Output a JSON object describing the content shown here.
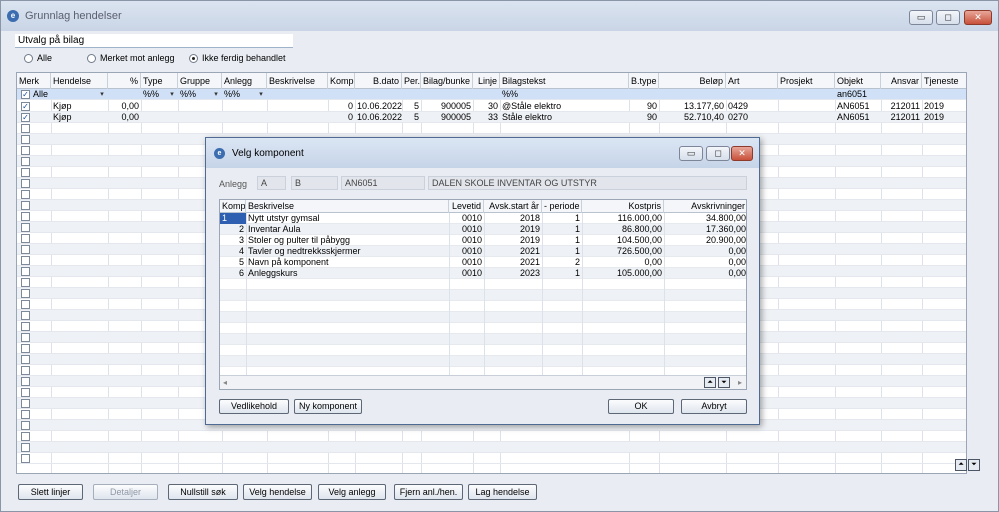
{
  "window": {
    "title": "Grunnlag hendelser",
    "icon": "app-logo-icon"
  },
  "window_buttons": {
    "minimize": "▭",
    "maximize": "◻",
    "close": "✕"
  },
  "selection": {
    "title": "Utvalg på bilag",
    "options": [
      {
        "label": "Alle",
        "selected": false
      },
      {
        "label": "Merket mot anlegg",
        "selected": false
      },
      {
        "label": "Ikke ferdig behandlet",
        "selected": true
      }
    ]
  },
  "grid": {
    "headers": [
      "Merk",
      "Hendelse",
      "%",
      "Type",
      "Gruppe",
      "Anlegg",
      "Beskrivelse",
      "Komp",
      "B.dato",
      "Per.",
      "Bilag/bunke",
      "Linje",
      "Bilagstekst",
      "B.type",
      "Beløp",
      "Art",
      "Prosjekt",
      "Objekt",
      "Ansvar",
      "Tjeneste"
    ],
    "filter_row": {
      "merk": "Alle",
      "type": "%%",
      "gruppe": "%%",
      "anlegg": "%%",
      "bilagstekst": "%%",
      "objekt": "an6051"
    },
    "rows": [
      {
        "merk": "✓",
        "hendelse": "Kjøp",
        "pct": "0,00",
        "komp": "0",
        "bdato": "10.06.2022",
        "per": "5",
        "bilag": "900005",
        "linje": "30",
        "bilagstekst": "@Ståle elektro",
        "btype": "90",
        "belop": "13.177,60",
        "art": "0429",
        "objekt": "AN6051",
        "ansvar": "212011",
        "tjeneste": "2019"
      },
      {
        "merk": "✓",
        "hendelse": "Kjøp",
        "pct": "0,00",
        "komp": "0",
        "bdato": "10.06.2022",
        "per": "5",
        "bilag": "900005",
        "linje": "33",
        "bilagstekst": "Ståle elektro",
        "btype": "90",
        "belop": "52.710,40",
        "art": "0270",
        "objekt": "AN6051",
        "ansvar": "212011",
        "tjeneste": "2019"
      }
    ]
  },
  "scroll_buttons": {
    "up": "⏶",
    "down": "⏷"
  },
  "footer_buttons": [
    "Slett linjer",
    "Detaljer",
    "Nullstill søk",
    "Velg hendelse",
    "Velg anlegg",
    "Fjern anl./hen.",
    "Lag hendelse"
  ],
  "dialog": {
    "title": "Velg komponent",
    "anlegg_label": "Anlegg",
    "fields": [
      "A",
      "B",
      "AN6051",
      "DALEN SKOLE INVENTAR OG UTSTYR"
    ],
    "headers": [
      "Komp",
      "Beskrivelse",
      "Levetid",
      "Avsk.start år",
      "- periode",
      "Kostpris",
      "Avskrivninger"
    ],
    "rows": [
      {
        "komp": "1",
        "beskrivelse": "Nytt utstyr gymsal",
        "levetid": "0010",
        "start": "2018",
        "periode": "1",
        "kostpris": "116.000,00",
        "avskr": "34.800,00"
      },
      {
        "komp": "2",
        "beskrivelse": "Inventar Aula",
        "levetid": "0010",
        "start": "2019",
        "periode": "1",
        "kostpris": "86.800,00",
        "avskr": "17.360,00"
      },
      {
        "komp": "3",
        "beskrivelse": "Stoler og pulter til påbygg",
        "levetid": "0010",
        "start": "2019",
        "periode": "1",
        "kostpris": "104.500,00",
        "avskr": "20.900,00"
      },
      {
        "komp": "4",
        "beskrivelse": "Tavler og nedtrekksskjermer",
        "levetid": "0010",
        "start": "2021",
        "periode": "1",
        "kostpris": "726.500,00",
        "avskr": "0,00"
      },
      {
        "komp": "5",
        "beskrivelse": "Navn på komponent",
        "levetid": "0010",
        "start": "2021",
        "periode": "2",
        "kostpris": "0,00",
        "avskr": "0,00"
      },
      {
        "komp": "6",
        "beskrivelse": "Anleggskurs",
        "levetid": "0010",
        "start": "2023",
        "periode": "1",
        "kostpris": "105.000,00",
        "avskr": "0,00"
      }
    ],
    "buttons": {
      "vedlikehold": "Vedlikehold",
      "ny": "Ny komponent",
      "ok": "OK",
      "avbryt": "Avbryt"
    }
  }
}
